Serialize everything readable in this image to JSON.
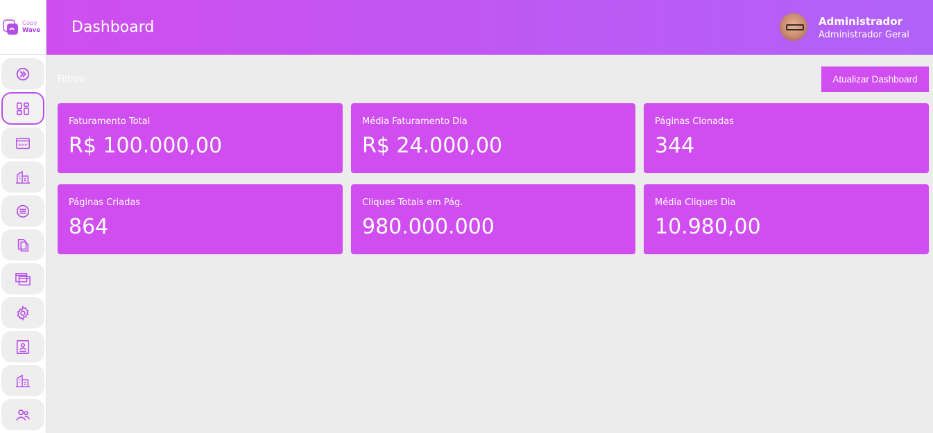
{
  "brand": {
    "line1": "Copy",
    "line2": "Wave"
  },
  "sidebar": {
    "items": [
      {
        "icon": "double-chevron-right-icon"
      },
      {
        "icon": "dashboard-grid-icon",
        "active": true
      },
      {
        "icon": "www-browser-icon"
      },
      {
        "icon": "building-icon"
      },
      {
        "icon": "list-circle-icon"
      },
      {
        "icon": "copy-files-icon"
      },
      {
        "icon": "windows-icon"
      },
      {
        "icon": "gear-icon"
      },
      {
        "icon": "user-card-icon"
      },
      {
        "icon": "building-icon"
      },
      {
        "icon": "users-icon"
      }
    ]
  },
  "header": {
    "title": "Dashboard",
    "user": {
      "name": "Administrador",
      "role": "Administrador Geral"
    }
  },
  "main": {
    "filters_label": "Filtros",
    "refresh_button": "Atualizar Dashboard",
    "cards": [
      {
        "label": "Faturamento Total",
        "value": "R$ 100.000,00"
      },
      {
        "label": "Média Faturamento Dia",
        "value": "R$ 24.000,00"
      },
      {
        "label": "Páginas Clonadas",
        "value": "344"
      },
      {
        "label": "Páginas Criadas",
        "value": "864"
      },
      {
        "label": "Cliques Totais em Pág.",
        "value": "980.000.000"
      },
      {
        "label": "Média Cliques Dia",
        "value": "10.980,00"
      }
    ]
  },
  "colors": {
    "accent": "#d04ef0",
    "header_start": "#cf4dee",
    "header_end": "#b062f8",
    "background": "#ececec",
    "icon": "#b84dea"
  }
}
